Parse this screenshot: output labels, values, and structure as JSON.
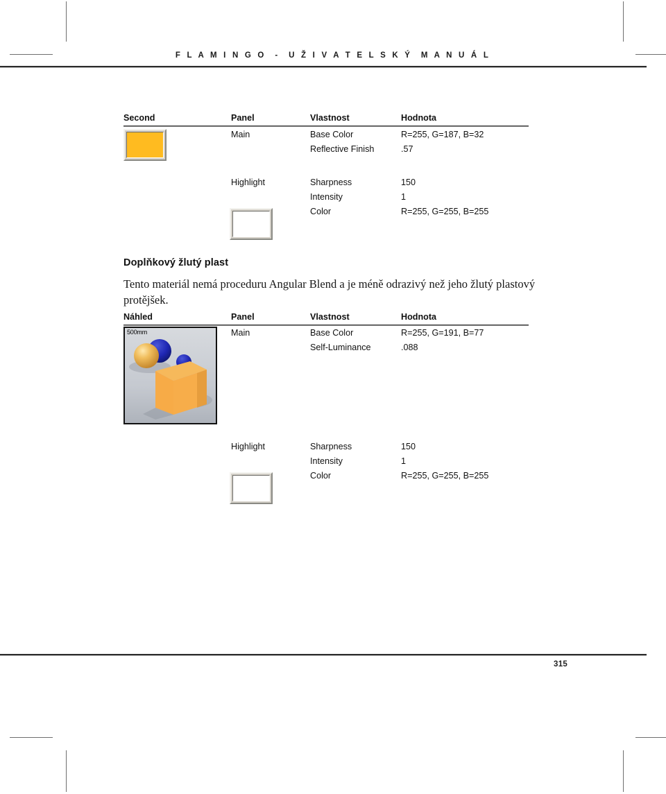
{
  "document": {
    "header_title": "F L A M I N G O  -  U Ž I V A T E L S K Ý  M A N U Á L",
    "page_number": "315"
  },
  "table_one": {
    "headers": {
      "preview": "Second",
      "panel": "Panel",
      "property": "Vlastnost",
      "value": "Hodnota"
    },
    "groups": [
      {
        "panel": "Main",
        "swatch_color": "#FFBB20",
        "rows": [
          {
            "property": "Base Color",
            "value": "R=255, G=187, B=32"
          },
          {
            "property": "Reflective Finish",
            "value": ".57"
          }
        ]
      },
      {
        "panel": "Highlight",
        "swatch_color": "#FFFFFF",
        "rows": [
          {
            "property": "Sharpness",
            "value": "150"
          },
          {
            "property": "Intensity",
            "value": "1"
          },
          {
            "property": "Color",
            "value": "R=255, G=255, B=255"
          }
        ]
      }
    ]
  },
  "section": {
    "heading": "Doplňkový žlutý plast",
    "paragraph": "Tento materiál nemá proceduru Angular Blend a je méně odrazivý než jeho žlutý plastový protějšek."
  },
  "table_two": {
    "headers": {
      "preview": "Náhled",
      "panel": "Panel",
      "property": "Vlastnost",
      "value": "Hodnota"
    },
    "thumbnail": {
      "scale_label": "500mm",
      "sphere_color": "#EDB24E",
      "cube_color": "#F5A94A",
      "accent_color": "#1B24B4",
      "background_color": "#C9CCD2"
    },
    "groups": [
      {
        "panel": "Main",
        "rows": [
          {
            "property": "Base Color",
            "value": "R=255, G=191, B=77"
          },
          {
            "property": "Self-Luminance",
            "value": ".088"
          }
        ]
      },
      {
        "panel": "Highlight",
        "swatch_color": "#FFFFFF",
        "rows": [
          {
            "property": "Sharpness",
            "value": "150"
          },
          {
            "property": "Intensity",
            "value": "1"
          },
          {
            "property": "Color",
            "value": "R=255, G=255, B=255"
          }
        ]
      }
    ]
  }
}
